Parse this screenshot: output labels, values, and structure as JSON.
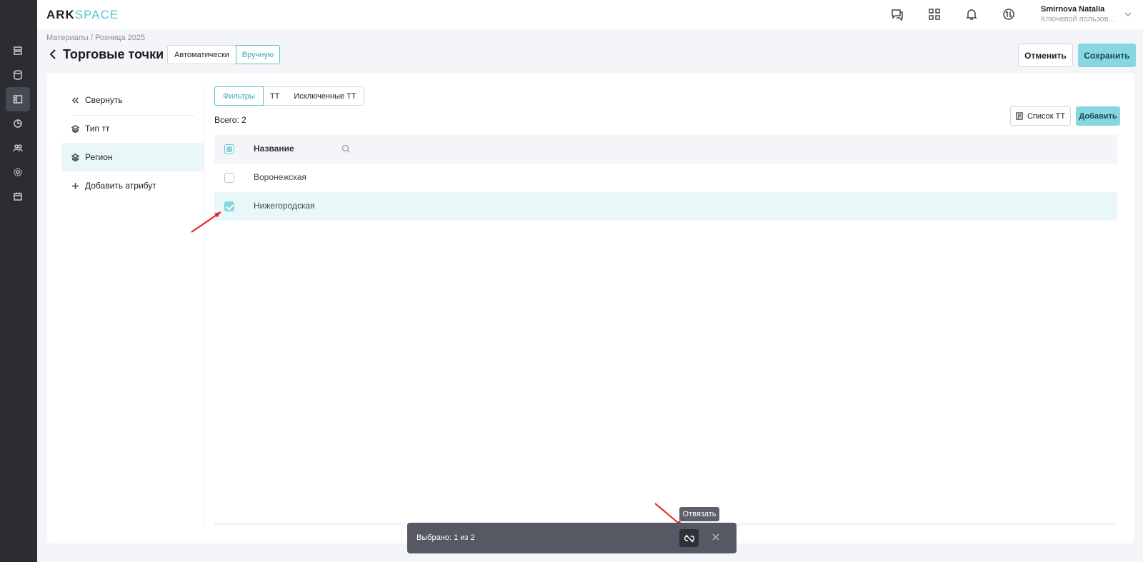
{
  "app": {
    "logo_ark": "ARK",
    "logo_space": "SPACE"
  },
  "user": {
    "name": "Smirnova Natalia",
    "role": "Ключевой пользов..."
  },
  "breadcrumb": "Материалы  /  Розница 2025",
  "page": {
    "title": "Торговые точки"
  },
  "mode": {
    "auto": "Автоматически",
    "manual": "Вручную"
  },
  "actions": {
    "cancel": "Отменить",
    "save": "Сохранить"
  },
  "sidebar": {
    "collapse": "Свернуть",
    "items": [
      {
        "label": "Тип тт"
      },
      {
        "label": "Регион"
      }
    ],
    "add_attribute": "Добавить атрибут"
  },
  "tabs": [
    "Фильтры",
    "ТТ",
    "Исключенные ТТ"
  ],
  "total": "Всего: 2",
  "toolbar": {
    "list": "Список ТТ",
    "add": "Добавить"
  },
  "table": {
    "header": "Название",
    "rows": [
      {
        "name": "Воронежская",
        "checked": false
      },
      {
        "name": "Нижегородская",
        "checked": true
      }
    ]
  },
  "selection_bar": {
    "text": "Выбрано: 1 из 2",
    "tooltip": "Отвязать"
  },
  "colors": {
    "accent": "#86d7df",
    "rail": "#2b2d33",
    "arrow": "#e52020"
  }
}
